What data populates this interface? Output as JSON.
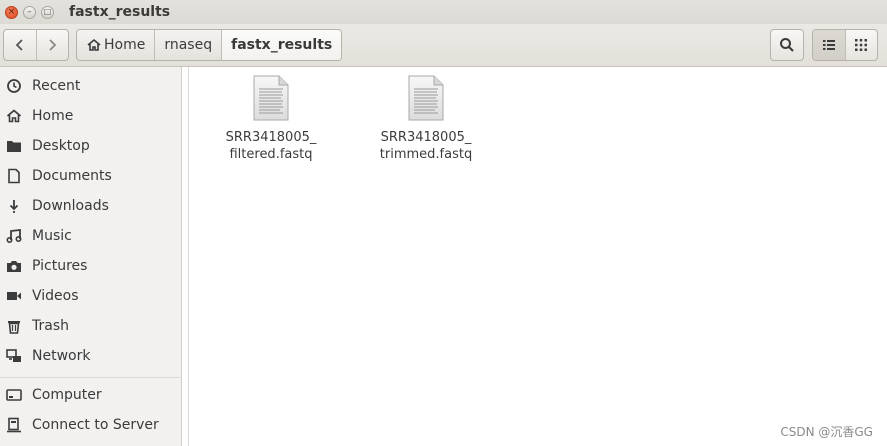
{
  "window": {
    "title": "fastx_results",
    "close_glyph": "×",
    "min_glyph": "–",
    "max_glyph": "□"
  },
  "toolbar": {
    "back_icon": "chevron-left-icon",
    "forward_icon": "chevron-right-icon",
    "breadcrumbs": [
      {
        "label": "Home",
        "icon": "home-icon"
      },
      {
        "label": "rnaseq"
      },
      {
        "label": "fastx_results",
        "active": true
      }
    ],
    "search_icon": "search-icon",
    "list_view_icon": "list-view-icon",
    "grid_view_icon": "grid-view-icon",
    "active_view": "list"
  },
  "sidebar": {
    "items": [
      {
        "label": "Recent",
        "icon": "clock-icon"
      },
      {
        "label": "Home",
        "icon": "home-icon"
      },
      {
        "label": "Desktop",
        "icon": "folder-icon"
      },
      {
        "label": "Documents",
        "icon": "document-icon"
      },
      {
        "label": "Downloads",
        "icon": "download-icon"
      },
      {
        "label": "Music",
        "icon": "music-icon"
      },
      {
        "label": "Pictures",
        "icon": "camera-icon"
      },
      {
        "label": "Videos",
        "icon": "video-icon"
      },
      {
        "label": "Trash",
        "icon": "trash-icon"
      },
      {
        "label": "Network",
        "icon": "network-icon"
      },
      {
        "label": "Computer",
        "icon": "drive-icon"
      },
      {
        "label": "Connect to Server",
        "icon": "server-icon"
      }
    ]
  },
  "files": [
    {
      "name_line1": "SRR3418005_",
      "name_line2": "filtered.fastq",
      "icon": "text-file-icon"
    },
    {
      "name_line1": "SRR3418005_",
      "name_line2": "trimmed.fastq",
      "icon": "text-file-icon"
    }
  ],
  "watermark": "CSDN @沉香GG",
  "colors": {
    "close_button": "#df4a1f",
    "sidebar_bg": "#f2f1f0",
    "toolbar_bg": "#e3e0da"
  }
}
